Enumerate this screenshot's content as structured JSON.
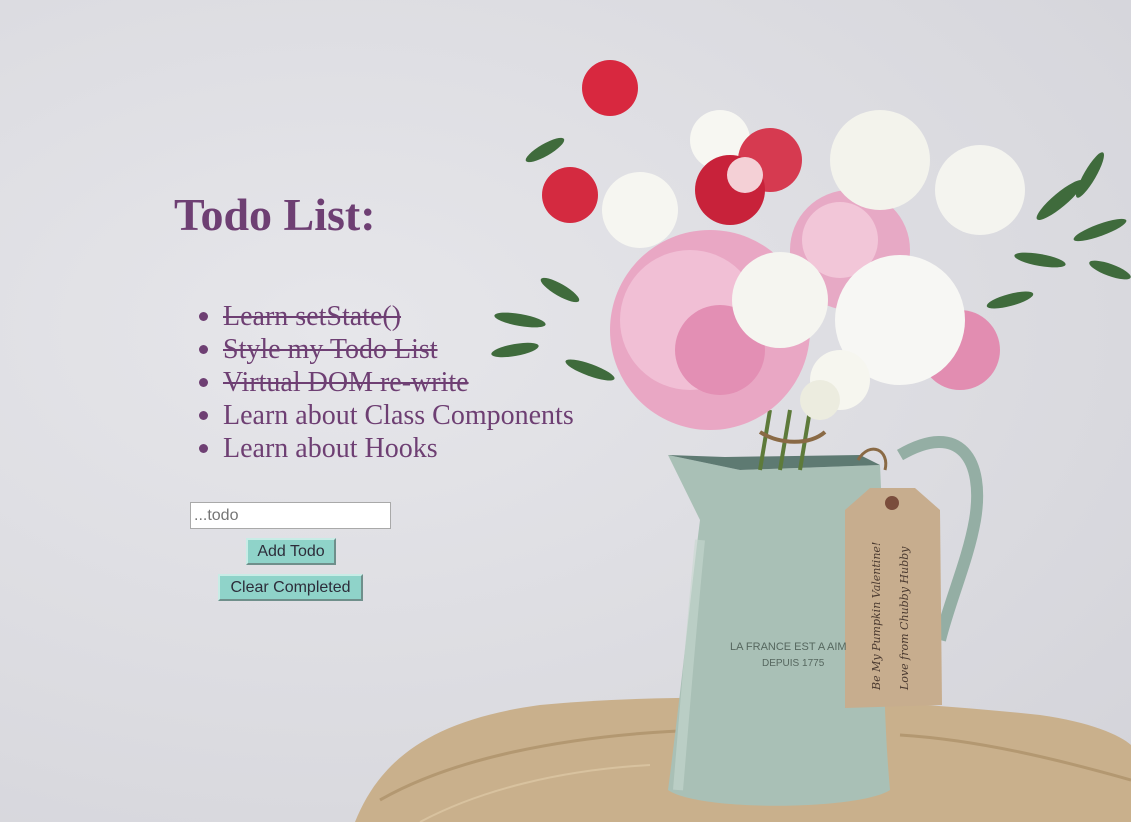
{
  "header": {
    "title": "Todo List:"
  },
  "todos": [
    {
      "label": "Learn setState()",
      "completed": true
    },
    {
      "label": "Style my Todo List",
      "completed": true
    },
    {
      "label": "Virtual DOM re-write",
      "completed": true
    },
    {
      "label": "Learn about Class Components",
      "completed": false
    },
    {
      "label": "Learn about Hooks",
      "completed": false
    }
  ],
  "form": {
    "input_placeholder": "...todo",
    "input_value": "",
    "add_label": "Add Todo",
    "clear_label": "Clear Completed"
  },
  "background": {
    "vase_text_line1": "LA FRANCE EST A AIM",
    "vase_text_line2": "DEPUIS 1775",
    "tag_text_line1": "Be My Pumpkin Valentine!",
    "tag_text_line2": "Love from Chubby Hubby"
  },
  "colors": {
    "text": "#6e3f73",
    "button": "#8fd3c9",
    "wall": "#dfdfe3"
  }
}
